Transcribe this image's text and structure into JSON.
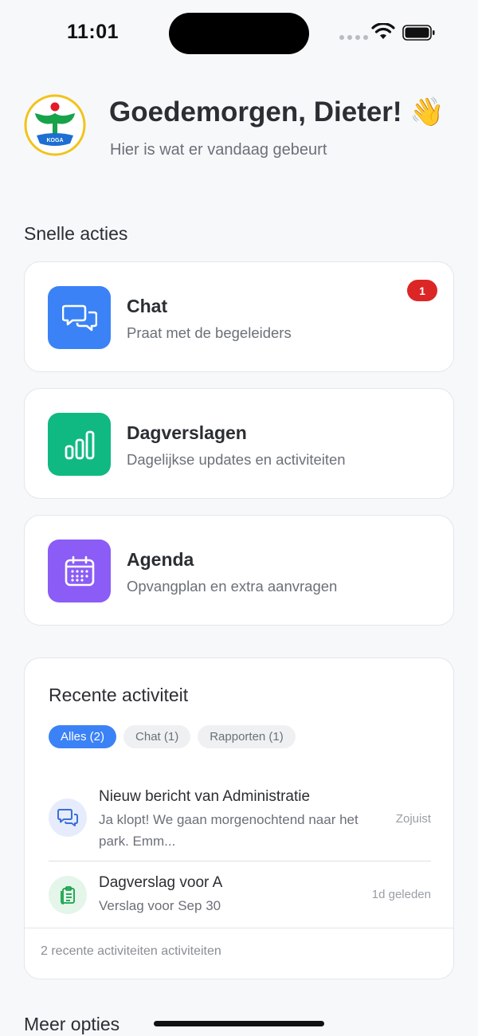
{
  "status_bar": {
    "time": "11:01"
  },
  "header": {
    "logo_text": "KOGA",
    "greeting": "Goedemorgen, Dieter! 👋",
    "subtitle": "Hier is wat er vandaag gebeurt"
  },
  "quick_actions": {
    "title": "Snelle acties",
    "items": [
      {
        "title": "Chat",
        "description": "Praat met de begeleiders",
        "badge": "1",
        "icon": "chat-bubbles-icon",
        "color": "#3b82f6"
      },
      {
        "title": "Dagverslagen",
        "description": "Dagelijkse updates en activiteiten",
        "icon": "bar-chart-icon",
        "color": "#10b981"
      },
      {
        "title": "Agenda",
        "description": "Opvangplan en extra aanvragen",
        "icon": "calendar-icon",
        "color": "#8b5cf6"
      }
    ]
  },
  "recent": {
    "title": "Recente activiteit",
    "filters": [
      {
        "label": "Alles (2)",
        "active": true
      },
      {
        "label": "Chat (1)",
        "active": false
      },
      {
        "label": "Rapporten (1)",
        "active": false
      }
    ],
    "items": [
      {
        "title": "Nieuw bericht van Administratie",
        "description": "Ja klopt! We gaan morgenochtend naar het park. Emm...",
        "time": "Zojuist",
        "icon": "chat-icon"
      },
      {
        "title": "Dagverslag voor A",
        "description": "Verslag voor Sep 30",
        "time": "1d geleden",
        "icon": "clipboard-icon"
      }
    ],
    "footer": "2 recente activiteiten activiteiten"
  },
  "more_options": {
    "title": "Meer opties"
  }
}
